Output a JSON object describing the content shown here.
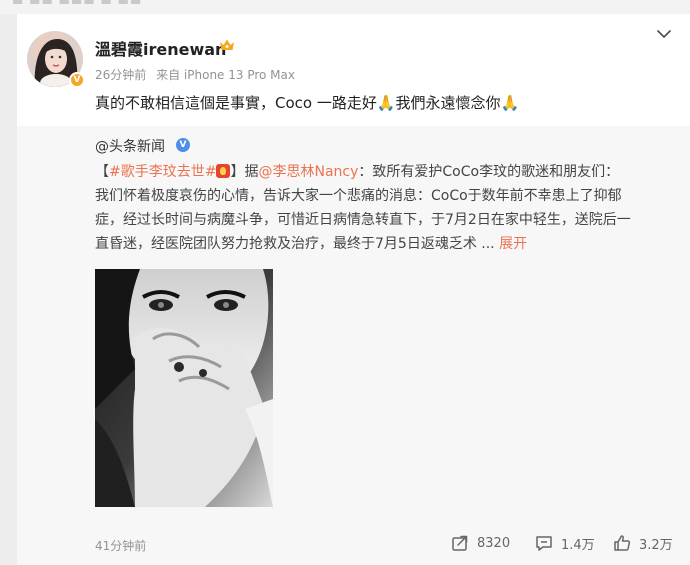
{
  "post": {
    "author": "溫碧霞irenewan",
    "time": "26分钟前",
    "source": "来自 iPhone 13 Pro Max",
    "text": "真的不敢相信這個是事實，Coco 一路走好🙏我們永遠懷念你🙏"
  },
  "repost": {
    "author": "@头条新闻",
    "line1": {
      "bracket_open": "【",
      "tag": "#歌手李玟去世#",
      "bracket_close": "】",
      "ju": "据",
      "mention": "@李思林Nancy",
      "rest": "：致所有爱护CoCo李玟的歌迷和朋友们："
    },
    "line2": "我们怀着极度哀伤的心情，告诉大家一个悲痛的消息：CoCo于数年前不幸患上了抑郁",
    "line3": "症，经过长时间与病魔斗争，可惜近日病情急转直下，于7月2日在家中轻生，送院后一",
    "line4": "直昏迷，经医院团队努力抢救及治疗，最终于7月5日返魂乏术 ... ",
    "expand": "展开",
    "time": "41分钟前",
    "stats": {
      "reposts": "8320",
      "comments": "1.4万",
      "likes": "3.2万"
    }
  },
  "colors": {
    "link": "#eb7350",
    "meta": "#939393",
    "repost_bg": "#f7f7f7"
  },
  "icons": [
    "chevron-down-icon",
    "verified-badge-icon",
    "vip-crown-icon",
    "fire-emoji-icon",
    "repost-icon",
    "comment-icon",
    "like-icon"
  ]
}
